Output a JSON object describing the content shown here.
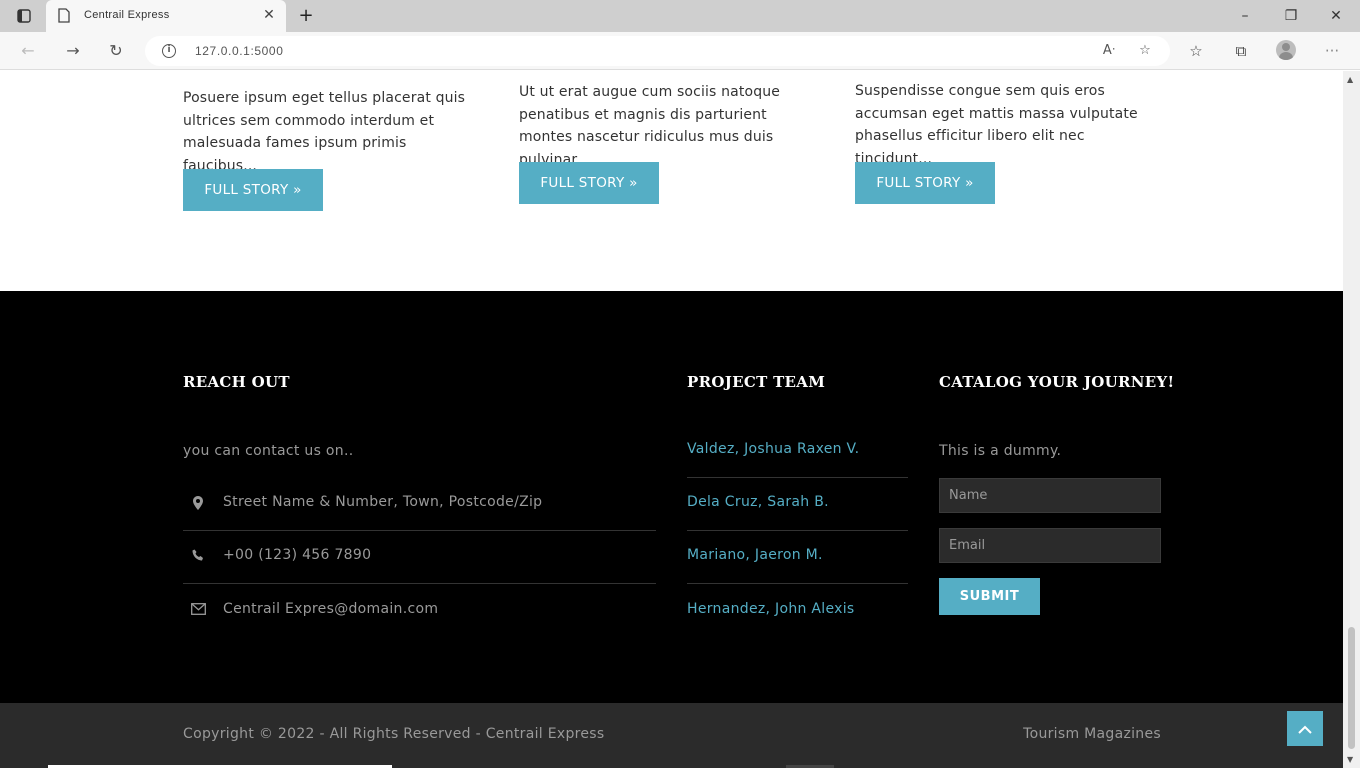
{
  "browser": {
    "tab_title": "Centrail Express",
    "new_tab_glyph": "+",
    "close_tab_glyph": "✕",
    "address": "127.0.0.1:5000",
    "window_controls": {
      "minimize": "–",
      "restore": "❐",
      "close": "✕"
    },
    "nav": {
      "back": "←",
      "forward": "→",
      "refresh": "↻"
    },
    "address_icons": {
      "read_aloud": "Aᐧ",
      "favorite": "☆"
    },
    "toolbar_icons": {
      "favorites": "☆",
      "collections": "⧉",
      "more": "···"
    }
  },
  "stories": [
    {
      "excerpt": "Posuere ipsum eget tellus placerat quis ultrices sem commodo interdum et malesuada fames ipsum primis faucibus...",
      "button": "FULL STORY »"
    },
    {
      "excerpt": "Ut ut erat augue cum sociis natoque penatibus et magnis dis parturient montes nascetur ridiculus mus duis pulvinar...",
      "button": "FULL STORY »"
    },
    {
      "excerpt": "Suspendisse congue sem quis eros accumsan eget mattis massa vulputate phasellus efficitur libero elit nec tincidunt...",
      "button": "FULL STORY »"
    }
  ],
  "footer": {
    "reach_out": {
      "heading": "REACH OUT",
      "intro": "you can contact us on..",
      "address": "Street Name & Number, Town, Postcode/Zip",
      "phone": "+00 (123) 456 7890",
      "email": "Centrail Expres@domain.com"
    },
    "team": {
      "heading": "PROJECT TEAM",
      "members": [
        "Valdez, Joshua Raxen V.",
        "Dela Cruz, Sarah B.",
        "Mariano, Jaeron M.",
        "Hernandez, John Alexis"
      ]
    },
    "catalog": {
      "heading": "CATALOG YOUR JOURNEY!",
      "text": "This is a dummy.",
      "name_placeholder": "Name",
      "email_placeholder": "Email",
      "submit": "SUBMIT"
    }
  },
  "bottom": {
    "copyright": "Copyright © 2022 - All Rights Reserved - Centrail Express",
    "magazine": "Tourism Magazines"
  },
  "colors": {
    "accent": "#55aec5",
    "footer_bg": "#000000",
    "bottom_bg": "#2b2b2b"
  }
}
